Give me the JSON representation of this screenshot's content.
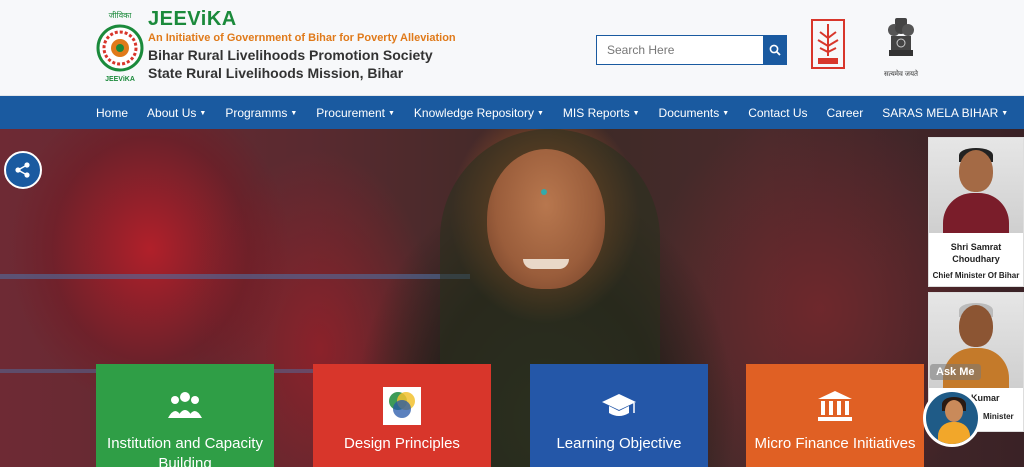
{
  "header": {
    "emblem_text_top": "जीविका",
    "emblem_text_bottom": "JEEViKA",
    "brand_name": "JEEViKA",
    "tagline": "An Initiative of Government of Bihar for Poverty Alleviation",
    "org_line1": "Bihar Rural Livelihoods Promotion Society",
    "org_line2": "State Rural Livelihoods Mission, Bihar",
    "search_placeholder": "Search Here",
    "ashoka_caption": "सत्यमेव जयते"
  },
  "nav": {
    "items": [
      {
        "label": "Home",
        "dropdown": false
      },
      {
        "label": "About Us",
        "dropdown": true
      },
      {
        "label": "Programms",
        "dropdown": true
      },
      {
        "label": "Procurement",
        "dropdown": true
      },
      {
        "label": "Knowledge Repository",
        "dropdown": true
      },
      {
        "label": "MIS Reports",
        "dropdown": true
      },
      {
        "label": "Documents",
        "dropdown": true
      },
      {
        "label": "Contact Us",
        "dropdown": false
      },
      {
        "label": "Career",
        "dropdown": false
      },
      {
        "label": "SARAS MELA BIHAR",
        "dropdown": true
      }
    ]
  },
  "cards": [
    {
      "label": "Institution and Capacity Building",
      "icon": "group-icon",
      "color": "#2f9e46"
    },
    {
      "label": "Design Principles",
      "icon": "venn-diagram-icon",
      "color": "#d8362b"
    },
    {
      "label": "Learning Objective",
      "icon": "graduation-cap-icon",
      "color": "#2457a8"
    },
    {
      "label": "Micro Finance Initiatives",
      "icon": "bank-building-icon",
      "color": "#e06024"
    }
  ],
  "side_panel": {
    "person1_name": "Shri Samrat Choudhary",
    "person1_role": "Chief Minister Of Bihar",
    "person2_name_partial": "an Kumar",
    "person2_role_partial": "Minister"
  },
  "assistant": {
    "label": "Ask Me"
  },
  "colors": {
    "nav_blue": "#1a5aa0",
    "brand_green": "#1b8a3b",
    "tagline_orange": "#e07a1a"
  }
}
